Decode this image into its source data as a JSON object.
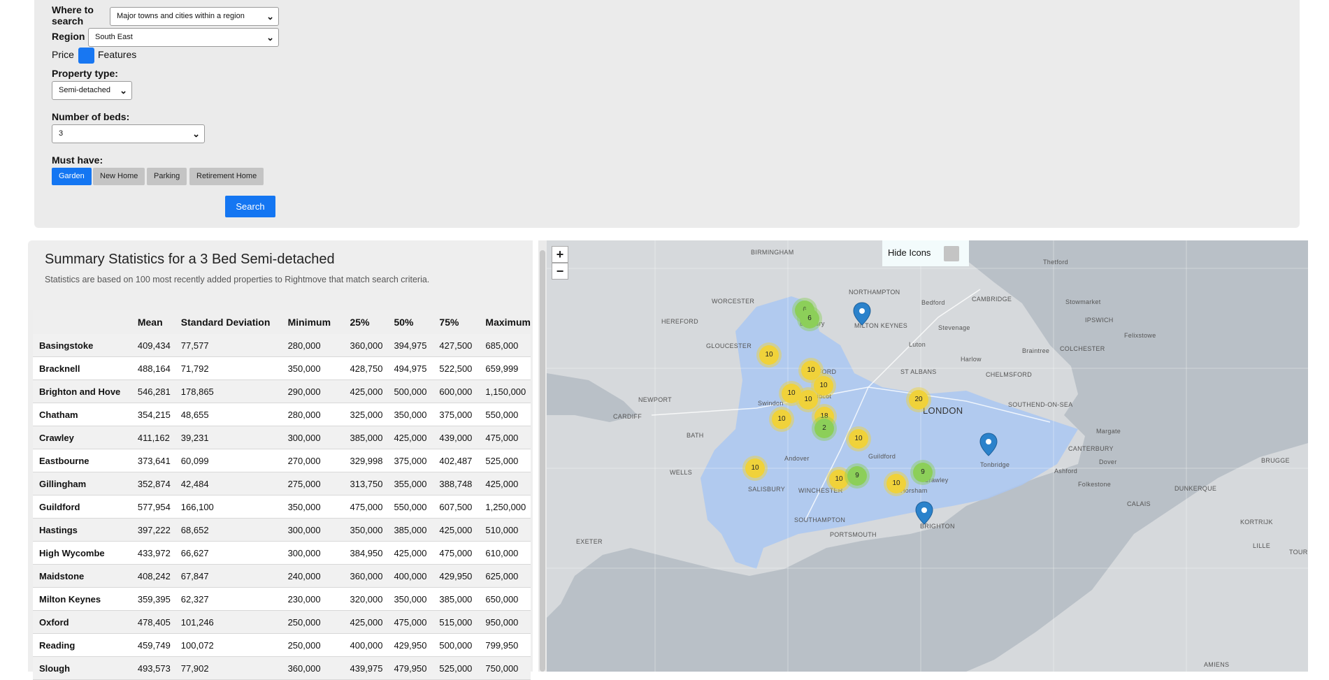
{
  "form": {
    "where_label": "Where to search",
    "where_value": "Major towns and cities within a region",
    "region_label": "Region",
    "region_value": "South East",
    "price_label": "Price",
    "features_label": "Features",
    "property_type_label": "Property type:",
    "property_type_value": "Semi-detached",
    "beds_label": "Number of beds:",
    "beds_value": "3",
    "must_have_label": "Must have:",
    "must_have": [
      {
        "label": "Garden",
        "active": true
      },
      {
        "label": "New Home",
        "active": false
      },
      {
        "label": "Parking",
        "active": false
      },
      {
        "label": "Retirement Home",
        "active": false
      }
    ],
    "search_label": "Search"
  },
  "summary": {
    "title": "Summary Statistics for a 3 Bed Semi-detached",
    "subtitle": "Statistics are based on 100 most recently added properties to Rightmove that match search criteria.",
    "columns": [
      "",
      "Mean",
      "Standard Deviation",
      "Minimum",
      "25%",
      "50%",
      "75%",
      "Maximum"
    ],
    "rows": [
      [
        "Basingstoke",
        "409,434",
        "77,577",
        "280,000",
        "360,000",
        "394,975",
        "427,500",
        "685,000"
      ],
      [
        "Bracknell",
        "488,164",
        "71,792",
        "350,000",
        "428,750",
        "494,975",
        "522,500",
        "659,999"
      ],
      [
        "Brighton and Hove",
        "546,281",
        "178,865",
        "290,000",
        "425,000",
        "500,000",
        "600,000",
        "1,150,000"
      ],
      [
        "Chatham",
        "354,215",
        "48,655",
        "280,000",
        "325,000",
        "350,000",
        "375,000",
        "550,000"
      ],
      [
        "Crawley",
        "411,162",
        "39,231",
        "300,000",
        "385,000",
        "425,000",
        "439,000",
        "475,000"
      ],
      [
        "Eastbourne",
        "373,641",
        "60,099",
        "270,000",
        "329,998",
        "375,000",
        "402,487",
        "525,000"
      ],
      [
        "Gillingham",
        "352,874",
        "42,484",
        "275,000",
        "313,750",
        "355,000",
        "388,748",
        "425,000"
      ],
      [
        "Guildford",
        "577,954",
        "166,100",
        "350,000",
        "475,000",
        "550,000",
        "607,500",
        "1,250,000"
      ],
      [
        "Hastings",
        "397,222",
        "68,652",
        "300,000",
        "350,000",
        "385,000",
        "425,000",
        "510,000"
      ],
      [
        "High Wycombe",
        "433,972",
        "66,627",
        "300,000",
        "384,950",
        "425,000",
        "475,000",
        "610,000"
      ],
      [
        "Maidstone",
        "408,242",
        "67,847",
        "240,000",
        "360,000",
        "400,000",
        "429,950",
        "625,000"
      ],
      [
        "Milton Keynes",
        "359,395",
        "62,327",
        "230,000",
        "320,000",
        "350,000",
        "385,000",
        "650,000"
      ],
      [
        "Oxford",
        "478,405",
        "101,246",
        "250,000",
        "425,000",
        "475,000",
        "515,000",
        "950,000"
      ],
      [
        "Reading",
        "459,749",
        "100,072",
        "250,000",
        "400,000",
        "429,950",
        "500,000",
        "799,950"
      ],
      [
        "Slough",
        "493,573",
        "77,902",
        "360,000",
        "439,975",
        "479,950",
        "525,000",
        "750,000"
      ]
    ]
  },
  "map": {
    "zoom_in": "+",
    "zoom_out": "−",
    "hide_icons_label": "Hide Icons",
    "clusters": [
      {
        "count": "6",
        "color": "g"
      },
      {
        "count": "6",
        "color": "g"
      },
      {
        "count": "10",
        "color": "y"
      },
      {
        "count": "10",
        "color": "y"
      },
      {
        "count": "10",
        "color": "y"
      },
      {
        "count": "10",
        "color": "y"
      },
      {
        "count": "10",
        "color": "y"
      },
      {
        "count": "10",
        "color": "y"
      },
      {
        "count": "18",
        "color": "y"
      },
      {
        "count": "2",
        "color": "g"
      },
      {
        "count": "10",
        "color": "y"
      },
      {
        "count": "20",
        "color": "y"
      },
      {
        "count": "10",
        "color": "y"
      },
      {
        "count": "10",
        "color": "y"
      },
      {
        "count": "9",
        "color": "g"
      },
      {
        "count": "10",
        "color": "y"
      },
      {
        "count": "9",
        "color": "g"
      }
    ],
    "labels": {
      "london": "LONDON",
      "birmingham": "BIRMINGHAM",
      "worcester": "WORCESTER",
      "hereford": "HEREFORD",
      "gloucester": "GLOUCESTER",
      "newport": "NEWPORT",
      "cardiff": "CARDIFF",
      "bath": "BATH",
      "wells": "WELLS",
      "salisbury": "SALISBURY",
      "winchester": "WINCHESTER",
      "southampton": "SOUTHAMPTON",
      "portsmouth": "PORTSMOUTH",
      "exeter": "EXETER",
      "northampton": "NORTHAMPTON",
      "milton_keynes": "MILTON KEYNES",
      "cambridge": "CAMBRIDGE",
      "ipswich": "IPSWICH",
      "colchester": "COLCHESTER",
      "chelmsford": "CHELMSFORD",
      "st_albans": "ST ALBANS",
      "canterbury": "CANTERBURY",
      "southend": "SOUTHEND-ON-SEA",
      "brighton": "BRIGHTON",
      "oxford": "OXFORD",
      "calais": "CALAIS",
      "dunkerque": "DUNKERQUE",
      "brugge": "BRUGGE",
      "lille": "LILLE",
      "kortrijk": "KORTRIJK",
      "tournai": "TOURNA",
      "amiens": "AMIENS",
      "thetford": "Thetford",
      "stowmarket": "Stowmarket",
      "felixstowe": "Felixstowe",
      "margate": "Margate",
      "ashford": "Ashford",
      "tonbridge": "Tonbridge",
      "crawley": "Crawley",
      "horsham": "Horsham",
      "guildford": "Guildford",
      "andover": "Andover",
      "swindon": "Swindon",
      "didcot": "Didcot",
      "banbury": "Banbury",
      "bedford": "Bedford",
      "luton": "Luton",
      "stevenage": "Stevenage",
      "harlow": "Harlow",
      "braintree": "Braintree",
      "dover": "Dover",
      "folkestone": "Folkestone"
    }
  }
}
